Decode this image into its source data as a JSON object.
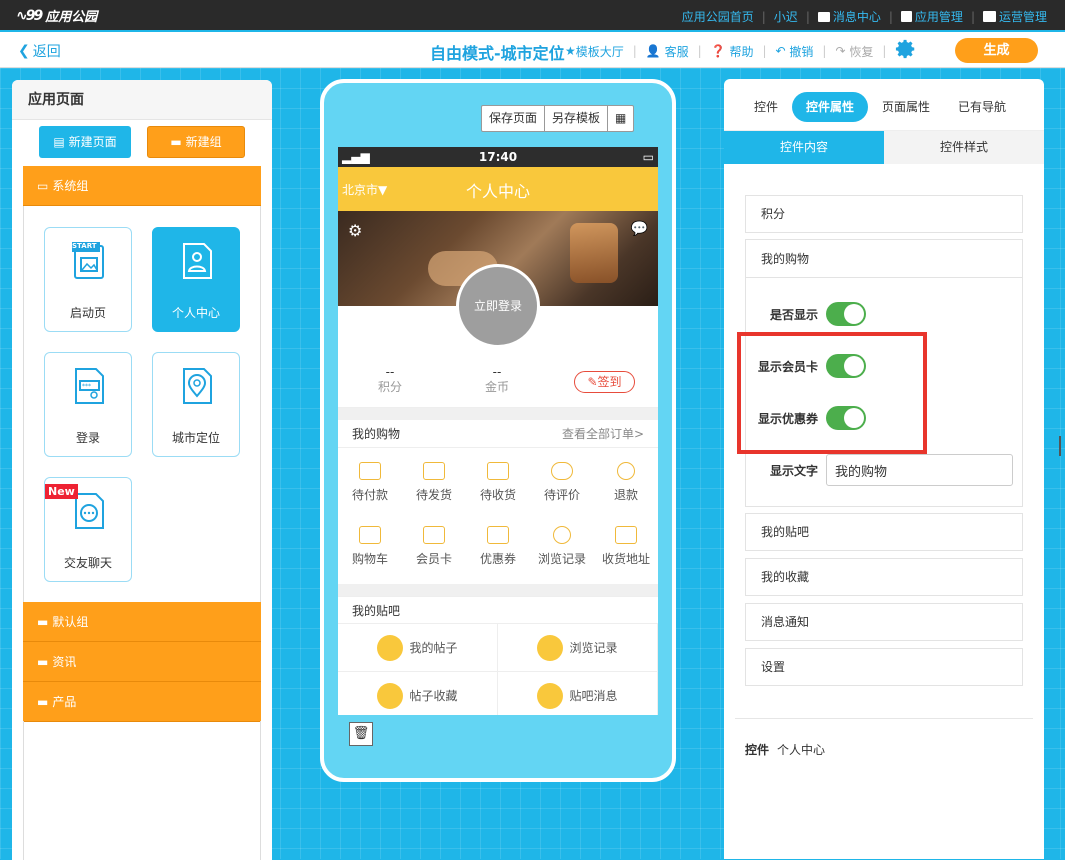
{
  "topbar": {
    "logo_text": "应用公园",
    "links": [
      "应用公园首页",
      "小迟",
      "消息中心",
      "应用管理",
      "运营管理"
    ]
  },
  "toolbar": {
    "back": "返回",
    "title": "自由模式-城市定位",
    "template_hall": "模板大厅",
    "service": "客服",
    "help": "帮助",
    "undo": "撤销",
    "redo": "恢复",
    "generate": "生成"
  },
  "left": {
    "title": "应用页面",
    "new_page": "新建页面",
    "new_group": "新建组",
    "group_system": "系统组",
    "cards": [
      "启动页",
      "个人中心",
      "登录",
      "城市定位",
      "交友聊天"
    ],
    "new_tag": "New",
    "start_tag": "START",
    "groups": [
      "默认组",
      "资讯",
      "产品"
    ]
  },
  "phone": {
    "save_page": "保存页面",
    "save_template": "另存模板",
    "status_time": "17:40",
    "city": "北京市▼",
    "header_title": "个人中心",
    "login": "立即登录",
    "stats": [
      {
        "value": "--",
        "label": "积分"
      },
      {
        "value": "--",
        "label": "金币"
      }
    ],
    "signin": "签到",
    "shop_title": "我的购物",
    "shop_more": "查看全部订单>",
    "shop_items": [
      "待付款",
      "待发货",
      "待收货",
      "待评价",
      "退款",
      "购物车",
      "会员卡",
      "优惠券",
      "浏览记录",
      "收货地址"
    ],
    "tie_title": "我的贴吧",
    "tie_items": [
      "我的帖子",
      "浏览记录",
      "帖子收藏",
      "贴吧消息"
    ]
  },
  "right": {
    "tabs": [
      "控件",
      "控件属性",
      "页面属性",
      "已有导航"
    ],
    "subtabs": [
      "控件内容",
      "控件样式"
    ],
    "items_top": [
      "积分"
    ],
    "shop_title": "我的购物",
    "toggles": [
      "是否显示",
      "显示会员卡",
      "显示优惠券"
    ],
    "show_text_label": "显示文字",
    "show_text_value": "我的购物",
    "items_bottom": [
      "我的贴吧",
      "我的收藏",
      "消息通知",
      "设置"
    ],
    "footer_label": "控件",
    "footer_value": "个人中心"
  },
  "colors": {
    "accent": "#1fb6e8",
    "orange": "#ff9f1a",
    "toggle": "#4cae4c",
    "highlight": "#e8352c"
  }
}
